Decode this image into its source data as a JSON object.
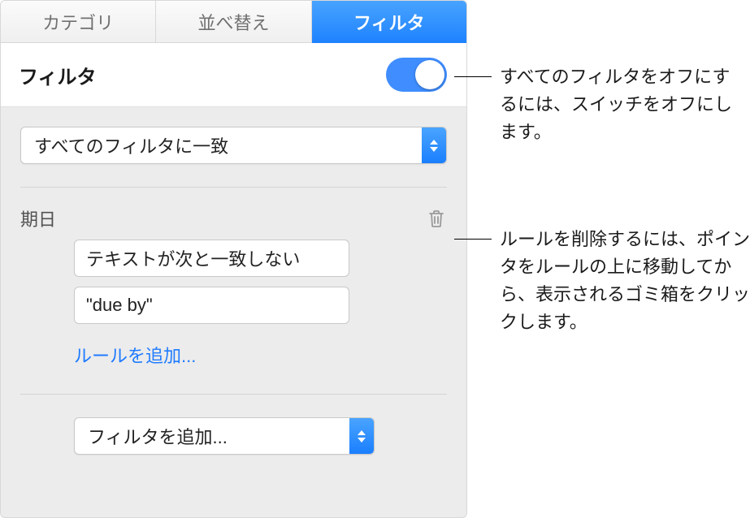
{
  "tabs": {
    "category": "カテゴリ",
    "sort": "並べ替え",
    "filter": "フィルタ"
  },
  "header": {
    "title": "フィルタ",
    "toggle_on": true
  },
  "match_select": {
    "label": "すべてのフィルタに一致"
  },
  "rule": {
    "field_label": "期日",
    "condition": "テキストが次と一致しない",
    "value": "\"due by\"",
    "add_rule_label": "ルールを追加..."
  },
  "add_filter": {
    "label": "フィルタを追加..."
  },
  "annotations": {
    "toggle_hint": "すべてのフィルタをオフにするには、スイッチをオフにします。",
    "trash_hint": "ルールを削除するには、ポインタをルールの上に移動してから、表示されるゴミ箱をクリックします。"
  }
}
